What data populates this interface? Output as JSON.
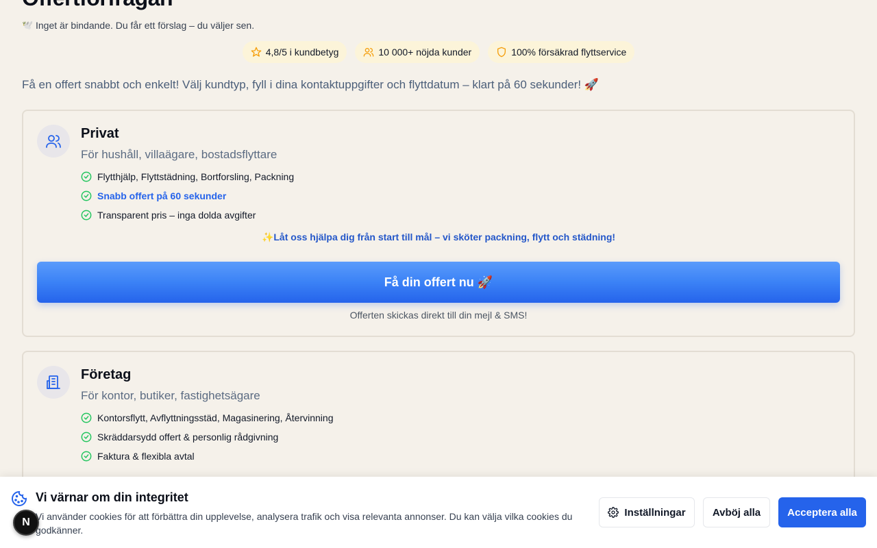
{
  "page": {
    "title": "Offertförfrågan",
    "subtitle_emoji": "🕊️",
    "subtitle": "Inget är bindande. Du får ett förslag – du väljer sen.",
    "intro": "Få en offert snabbt och enkelt! Välj kundtyp, fyll i dina kontaktuppgifter och flyttdatum – klart på 60 sekunder! 🚀"
  },
  "badges": [
    {
      "icon": "star-icon",
      "label": "4,8/5 i kundbetyg"
    },
    {
      "icon": "users-icon",
      "label": "10 000+ nöjda kunder"
    },
    {
      "icon": "shield-icon",
      "label": "100% försäkrad flyttservice"
    }
  ],
  "cards": {
    "privat": {
      "title": "Privat",
      "subtitle": "För hushåll, villaägare, bostadsflyttare",
      "features": [
        "Flytthjälp, Flyttstädning, Bortforsling, Packning",
        "Snabb offert på 60 sekunder",
        "Transparent pris – inga dolda avgifter"
      ],
      "promo": "✨Låt oss hjälpa dig från start till mål – vi sköter packning, flytt och städning!",
      "cta": "Få din offert nu 🚀",
      "cta_note": "Offerten skickas direkt till din mejl & SMS!"
    },
    "foretag": {
      "title": "Företag",
      "subtitle": "För kontor, butiker, fastighetsägare",
      "features": [
        "Kontorsflytt, Avflyttningsstäd, Magasinering, Återvinning",
        "Skräddarsydd offert & personlig rådgivning",
        "Faktura & flexibla avtal"
      ]
    }
  },
  "cookie_banner": {
    "title": "Vi värnar om din integritet",
    "text": "Vi använder cookies för att förbättra din upplevelse, analysera trafik och visa relevanta annonser. Du kan välja vilka cookies du godkänner.",
    "settings_label": "Inställningar",
    "reject_label": "Avböj alla",
    "accept_label": "Acceptera alla"
  },
  "dev_badge": {
    "letter": "N"
  },
  "colors": {
    "accent": "#2563eb",
    "background": "#f5f1ea",
    "badge_bg": "#fcf4d9",
    "check": "#22c55e",
    "star": "#f59e0b"
  }
}
